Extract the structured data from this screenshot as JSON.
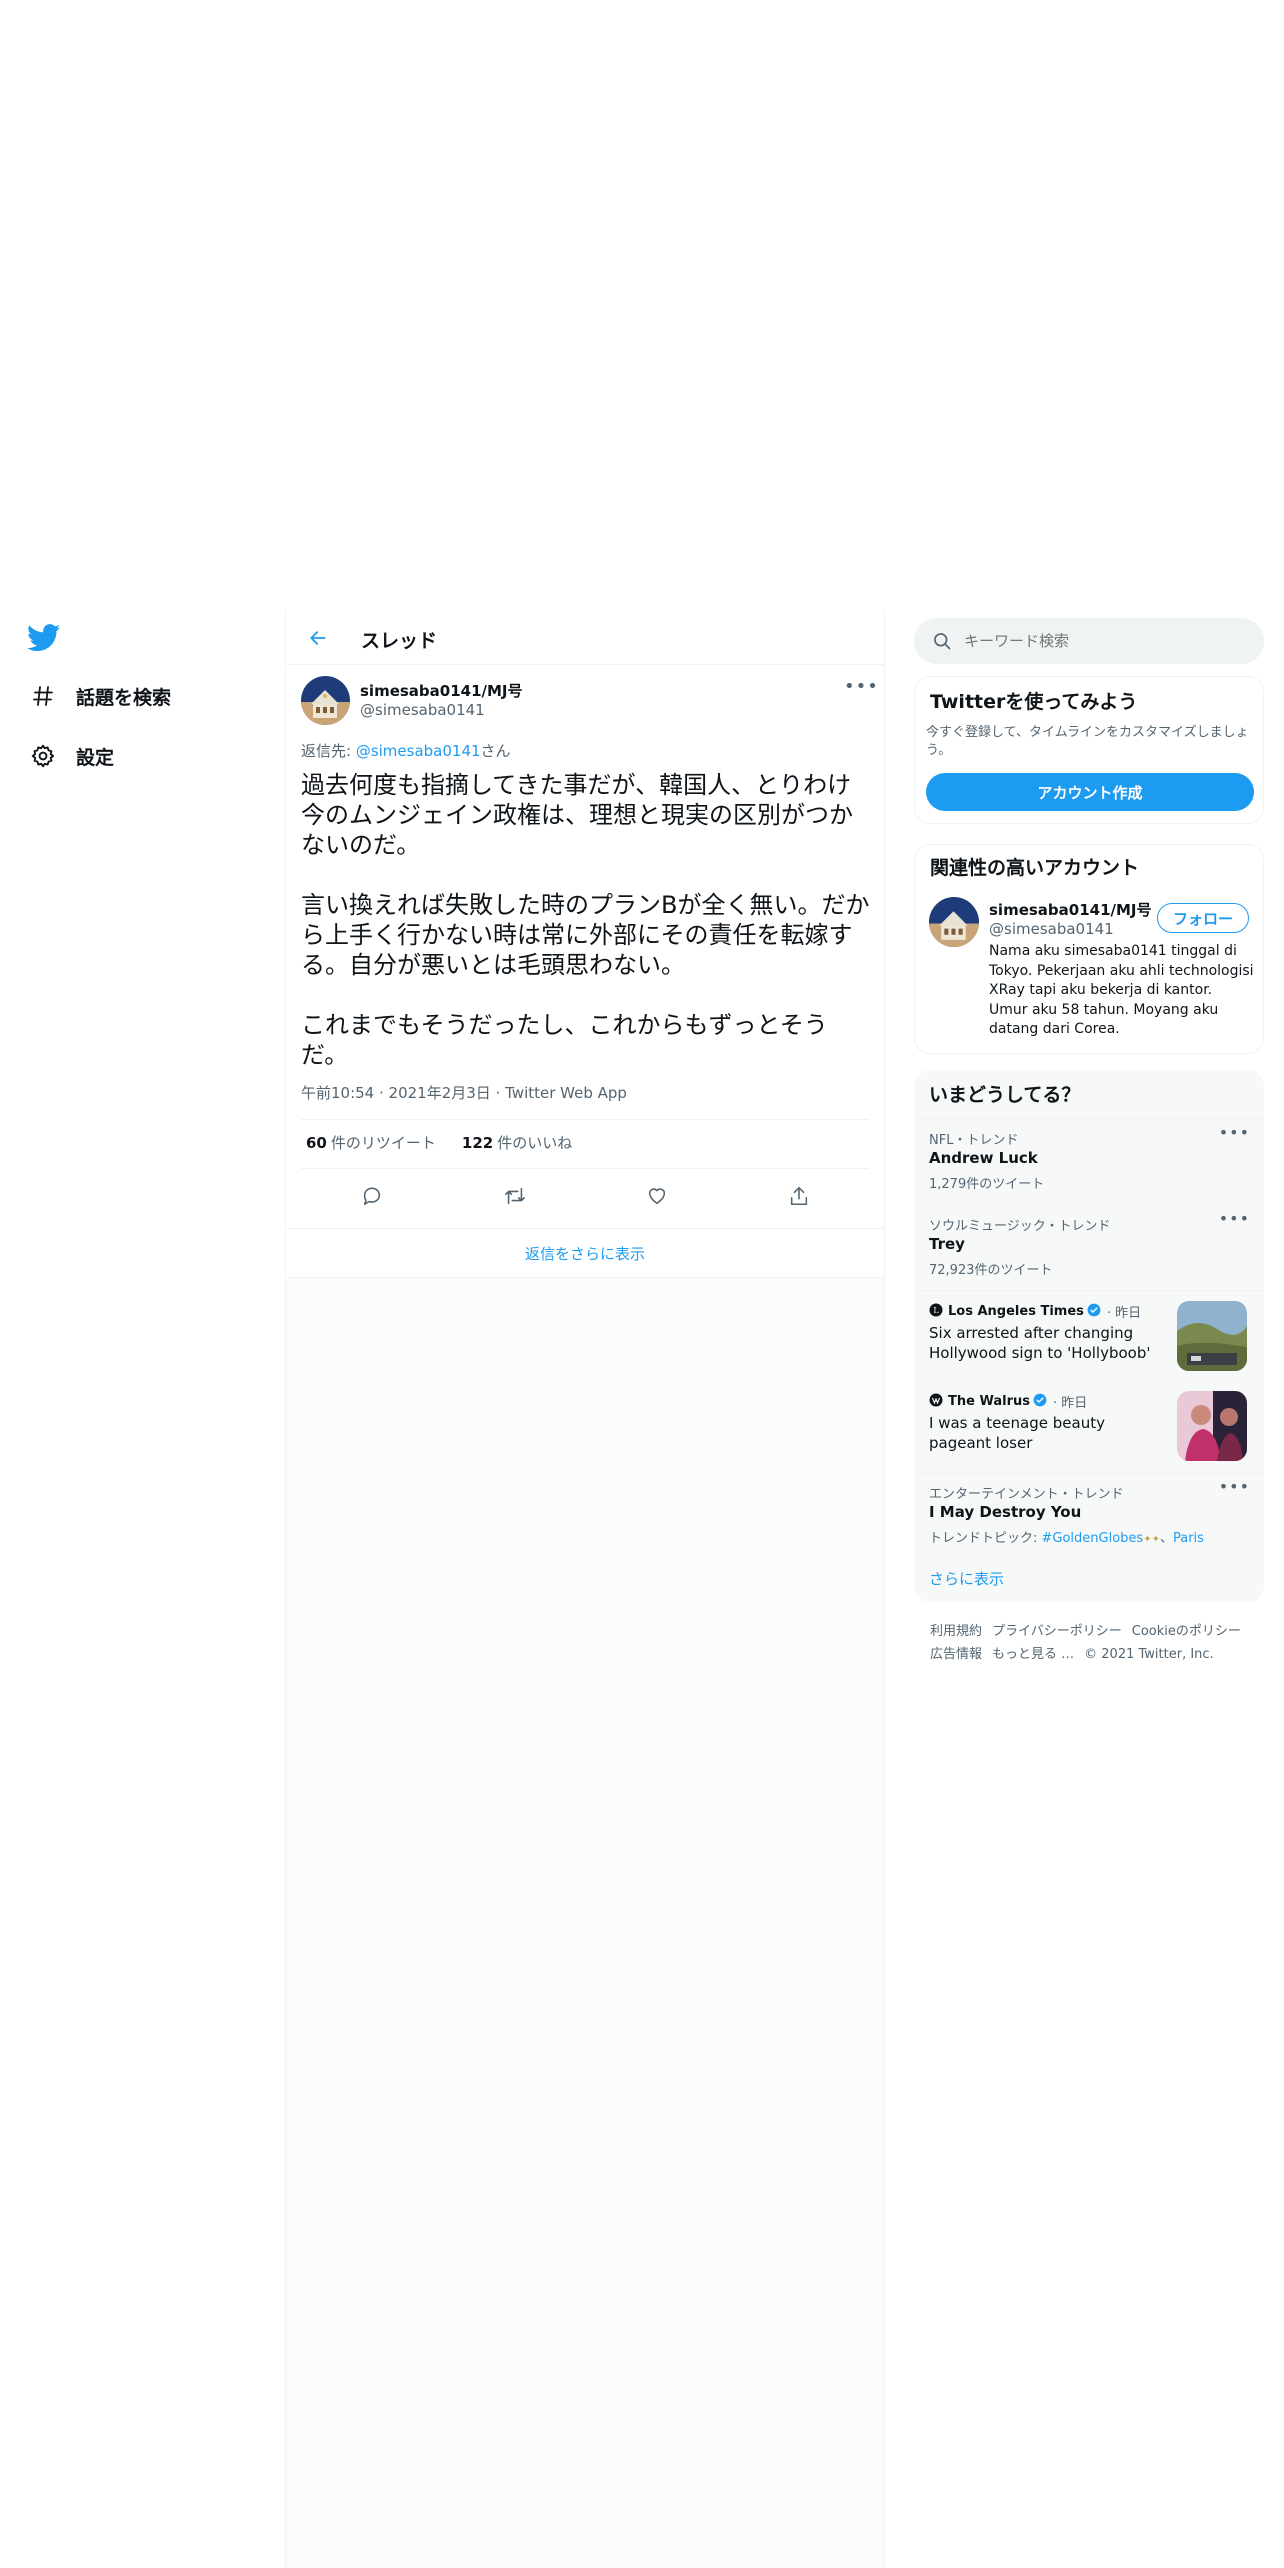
{
  "nav": {
    "items": [
      {
        "label": "話題を検索",
        "icon": "hashtag-icon"
      },
      {
        "label": "設定",
        "icon": "gear-icon"
      }
    ]
  },
  "thread": {
    "header_title": "スレッド",
    "author": {
      "name": "simesaba0141/MJ号",
      "handle": "@simesaba0141"
    },
    "reply_prefix": "返信先: ",
    "reply_mention": "@simesaba0141",
    "reply_suffix": "さん",
    "text": "過去何度も指摘してきた事だが、韓国人、とりわけ今のムンジェイン政権は、理想と現実の区別がつかないのだ。\n\n言い換えれば失敗した時のプランBが全く無い。だから上手く行かない時は常に外部にその責任を転嫁する。自分が悪いとは毛頭思わない。\n\nこれまでもそうだったし、これからもずっとそうだ。",
    "time": "午前10:54",
    "date": "2021年2月3日",
    "client": "Twitter Web App",
    "retweets": "60",
    "retweets_label": "件のリツイート",
    "likes": "122",
    "likes_label": "件のいいね",
    "show_more_replies": "返信をさらに表示"
  },
  "sidebar": {
    "search_placeholder": "キーワード検索",
    "signup": {
      "title": "Twitterを使ってみよう",
      "text": "今すぐ登録して、タイムラインをカスタマイズしましょう。",
      "button": "アカウント作成"
    },
    "relevant": {
      "title": "関連性の高いアカウント",
      "name": "simesaba0141/MJ号",
      "handle": "@simesaba0141",
      "follow": "フォロー",
      "bio": "Nama aku simesaba0141 tinggal di Tokyo. Pekerjaan aku ahli technologisi XRay tapi aku bekerja di kantor. Umur aku 58 tahun. Moyang aku datang dari Corea."
    },
    "trends": {
      "title": "いまどうしてる？",
      "items": [
        {
          "context": "NFL・トレンド",
          "title": "Andrew Luck",
          "count": "1,279件のツイート"
        },
        {
          "context": "ソウルミュージック・トレンド",
          "title": "Trey",
          "count": "72,923件のツイート"
        }
      ],
      "news": [
        {
          "source": "Los Angeles Times",
          "time": "昨日",
          "headline": "Six arrested after changing Hollywood sign to 'Hollyboob'"
        },
        {
          "source": "The Walrus",
          "time": "昨日",
          "headline": "I was a teenage beauty pageant loser"
        }
      ],
      "ent": {
        "context": "エンターテインメント・トレンド",
        "title": "I May Destroy You",
        "topics_prefix": "トレンドトピック: ",
        "tag1": "#GoldenGlobes",
        "tag2": "Paris"
      },
      "show_more": "さらに表示"
    },
    "footer": {
      "links": [
        "利用規約",
        "プライバシーポリシー",
        "Cookieのポリシー",
        "広告情報",
        "もっと見る …"
      ],
      "copyright": "© 2021 Twitter, Inc."
    }
  },
  "colors": {
    "accent": "#1d9bf0",
    "text": "#0f1419",
    "muted": "#536471",
    "border": "#eff3f4"
  }
}
